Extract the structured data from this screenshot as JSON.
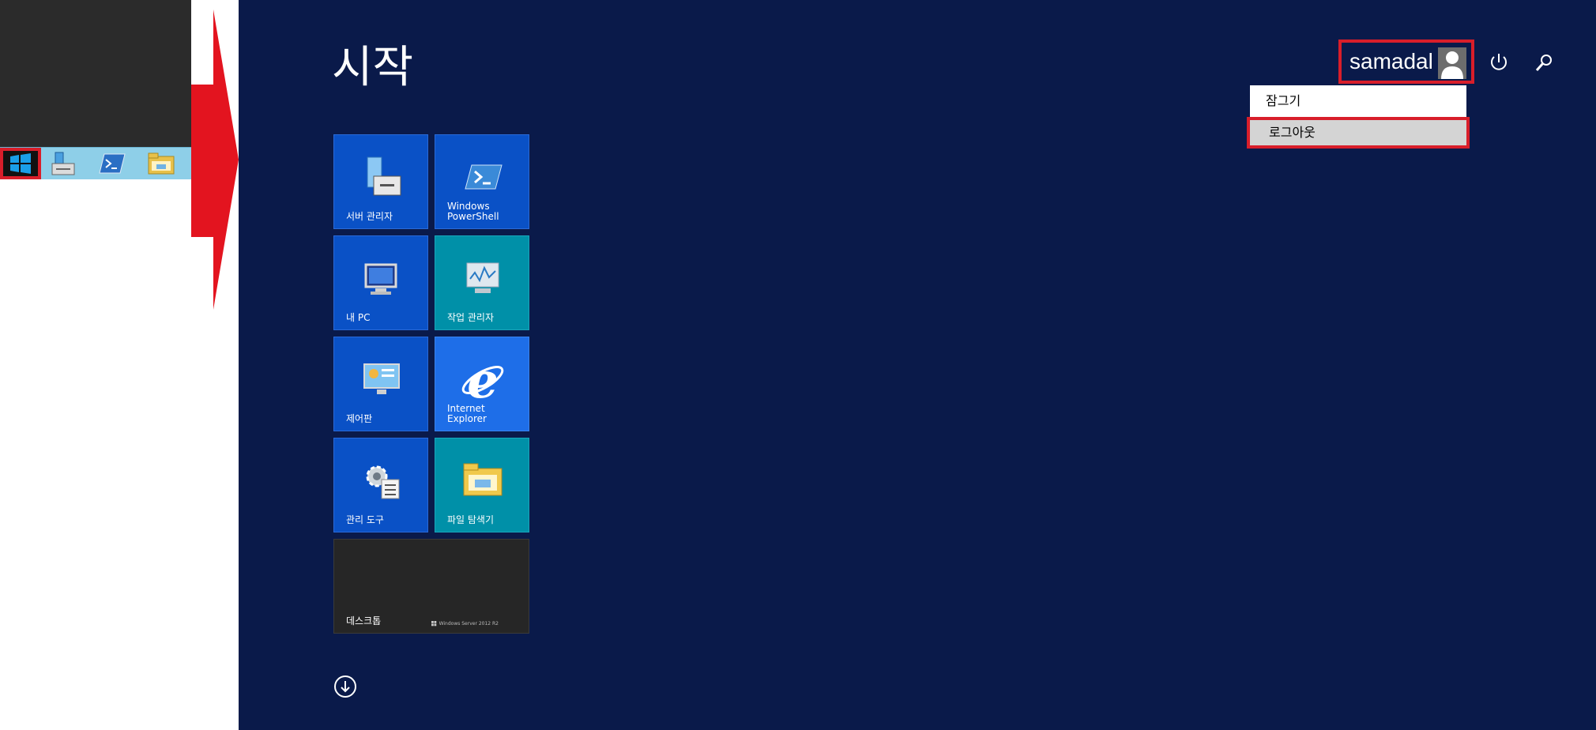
{
  "start_screen": {
    "title": "시작"
  },
  "user": {
    "name": "samadal"
  },
  "user_menu": {
    "items": [
      "잠그기",
      "로그아웃"
    ],
    "selected_index": 1
  },
  "tiles": [
    {
      "label": "서버 관리자",
      "icon": "server-manager-icon",
      "color": "#0a51c6"
    },
    {
      "label": "Windows PowerShell",
      "icon": "powershell-icon",
      "color": "#0a51c6"
    },
    {
      "label": "내 PC",
      "icon": "this-pc-icon",
      "color": "#0a51c6"
    },
    {
      "label": "작업 관리자",
      "icon": "task-manager-icon",
      "color": "#0090a8"
    },
    {
      "label": "제어판",
      "icon": "control-panel-icon",
      "color": "#0a51c6"
    },
    {
      "label": "Internet Explorer",
      "icon": "internet-explorer-icon",
      "color": "#1e6ee8"
    },
    {
      "label": "관리 도구",
      "icon": "admin-tools-icon",
      "color": "#0a51c6"
    },
    {
      "label": "파일 탐색기",
      "icon": "file-explorer-icon",
      "color": "#0090a8"
    },
    {
      "label": "데스크톱",
      "icon": "desktop-icon",
      "color": "#262626"
    }
  ],
  "desktop_tile_caption": "Windows Server 2012 R2",
  "taskbar": {
    "items": [
      "start-button",
      "server-manager-icon",
      "powershell-icon",
      "file-explorer-icon"
    ]
  },
  "colors": {
    "start_bg": "#0a1a4a",
    "highlight": "#d81e2a",
    "taskbar": "#8ecfe8"
  }
}
